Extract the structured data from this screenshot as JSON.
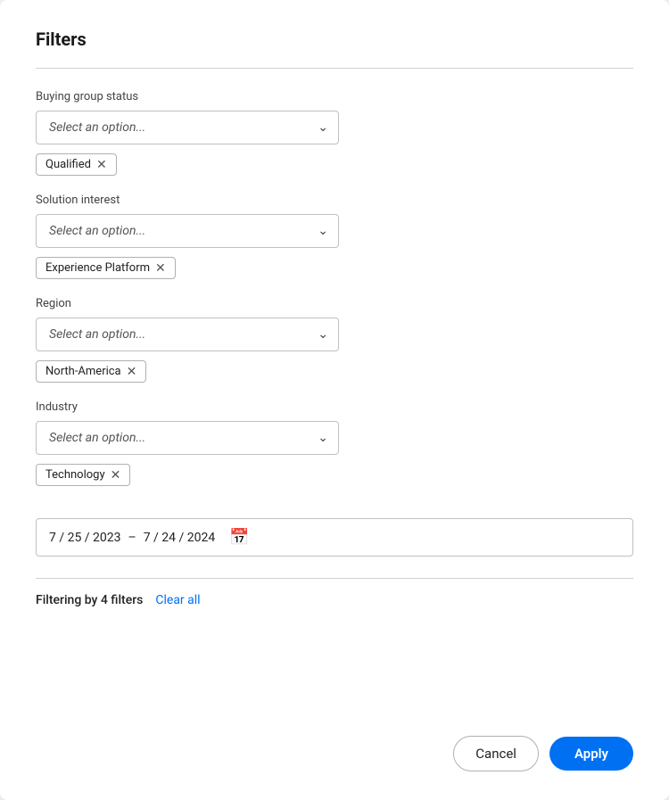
{
  "modal": {
    "title": "Filters",
    "sections": [
      {
        "id": "buying-group-status",
        "label": "Buying group status",
        "placeholder": "Select an option...",
        "tags": [
          {
            "label": "Qualified",
            "id": "qualified-tag"
          }
        ]
      },
      {
        "id": "solution-interest",
        "label": "Solution interest",
        "placeholder": "Select an option...",
        "tags": [
          {
            "label": "Experience Platform",
            "id": "experience-platform-tag"
          }
        ]
      },
      {
        "id": "region",
        "label": "Region",
        "placeholder": "Select an option...",
        "tags": [
          {
            "label": "North-America",
            "id": "north-america-tag"
          }
        ]
      },
      {
        "id": "industry",
        "label": "Industry",
        "placeholder": "Select an option...",
        "tags": [
          {
            "label": "Technology",
            "id": "technology-tag"
          }
        ]
      }
    ],
    "date_range": {
      "start": "7 / 25 / 2023",
      "separator": "–",
      "end": "7 / 24 / 2024"
    },
    "footer": {
      "filtering_text": "Filtering by 4 filters",
      "clear_all_label": "Clear all"
    },
    "actions": {
      "cancel_label": "Cancel",
      "apply_label": "Apply"
    }
  }
}
